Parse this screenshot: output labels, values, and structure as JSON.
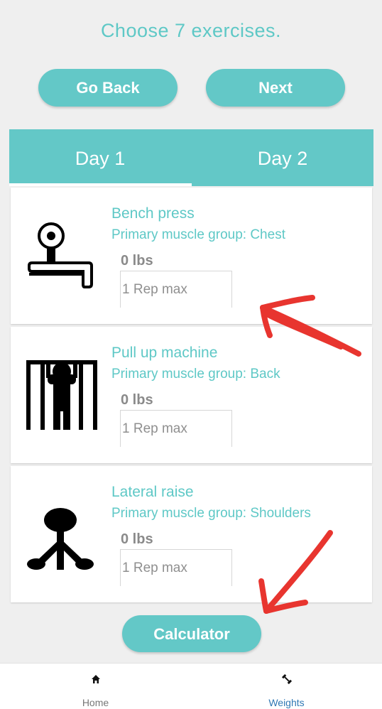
{
  "header": {
    "title": "Choose 7 exercises."
  },
  "buttons": {
    "back": "Go Back",
    "next": "Next",
    "calculator": "Calculator"
  },
  "tabs": [
    {
      "label": "Day 1",
      "selected": true
    },
    {
      "label": "Day 2",
      "selected": false
    }
  ],
  "exercises": [
    {
      "name": "Bench press",
      "muscle": "Primary muscle group: Chest",
      "weight": "0 lbs",
      "placeholder": "1 Rep max",
      "icon": "bench-press-icon"
    },
    {
      "name": "Pull up machine",
      "muscle": "Primary muscle group: Back",
      "weight": "0 lbs",
      "placeholder": "1 Rep max",
      "icon": "pull-up-icon"
    },
    {
      "name": "Lateral raise",
      "muscle": "Primary muscle group: Shoulders",
      "weight": "0 lbs",
      "placeholder": "1 Rep max",
      "icon": "lateral-raise-icon"
    }
  ],
  "bottom_nav": [
    {
      "label": "Home",
      "icon": "home-icon",
      "active": false
    },
    {
      "label": "Weights",
      "icon": "dumbbell-icon",
      "active": true
    }
  ],
  "colors": {
    "accent": "#63c8c7",
    "annotation": "#e8352f",
    "nav_active": "#2f78b4",
    "nav_inactive": "#777777"
  }
}
